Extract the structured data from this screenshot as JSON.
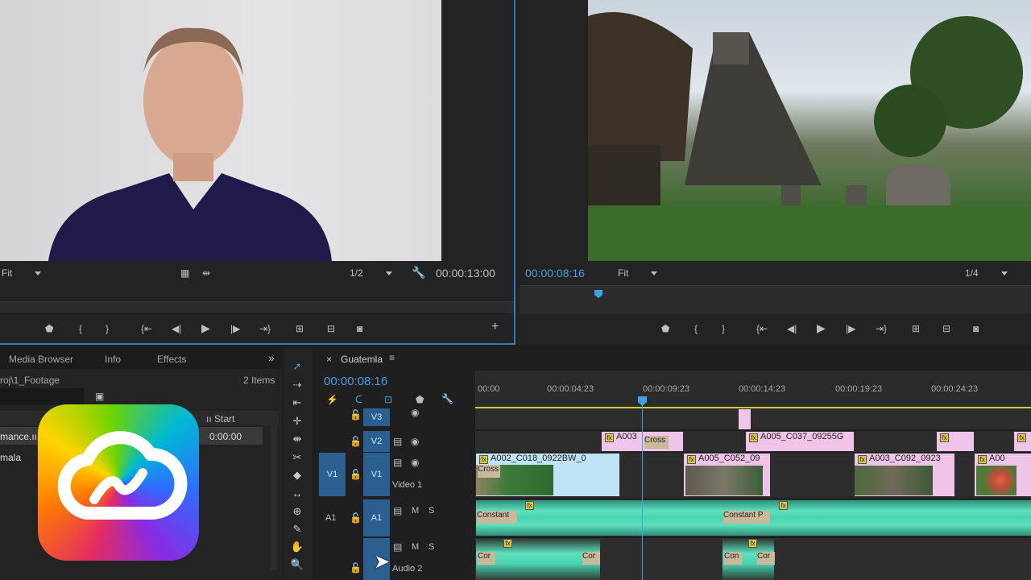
{
  "source_monitor": {
    "fit_label": "Fit",
    "resolution": "1/2",
    "timecode": "00:00:13:00"
  },
  "program_monitor": {
    "timecode": "00:00:08:16",
    "fit_label": "Fit",
    "resolution": "1/4"
  },
  "project_panel": {
    "tabs": [
      "Media Browser",
      "Info",
      "Effects"
    ],
    "path": "roj\\1_Footage",
    "items_count": "2 Items",
    "column_start": "ıı Start",
    "row1_name": "mance.ıı",
    "row1_start": "0:00:00",
    "row2_name": "mala"
  },
  "timeline": {
    "sequence_name": "Guatemla",
    "timecode": "00:00:08:16",
    "ruler": [
      "00:00",
      "00:00:04:23",
      "00:00:09:23",
      "00:00:14:23",
      "00:00:19:23",
      "00:00:24:23"
    ],
    "tracks": {
      "v3": "V3",
      "v2": "V2",
      "v1_src": "V1",
      "v1": "V1",
      "video1": "Video 1",
      "a1_src": "A1",
      "a1": "A1",
      "audio2": "Audio 2",
      "m": "M",
      "s": "S"
    },
    "clips": {
      "v2_a": "A003",
      "v2_cross": "Cross",
      "v2_b": "A005_C037_09255G",
      "v1_cross": "Cross",
      "v1_a": "A002_C018_0922BW_0",
      "v1_b": "A005_C052_09",
      "v1_c": "A003_C092_0923",
      "v1_d": "A00",
      "a1_const1": "Constant",
      "a1_const2": "Constant P",
      "a2_c1": "Cor",
      "a2_c2": "Cor",
      "a2_c3": "Con",
      "a2_c4": "Cor"
    }
  },
  "colors": {
    "accent_blue": "#3ea0e6",
    "clip_pink": "#f0c3e8",
    "clip_lightblue": "#bfe4f7",
    "audio_green": "#5ee0bd"
  },
  "logo": "Adobe Creative Cloud"
}
